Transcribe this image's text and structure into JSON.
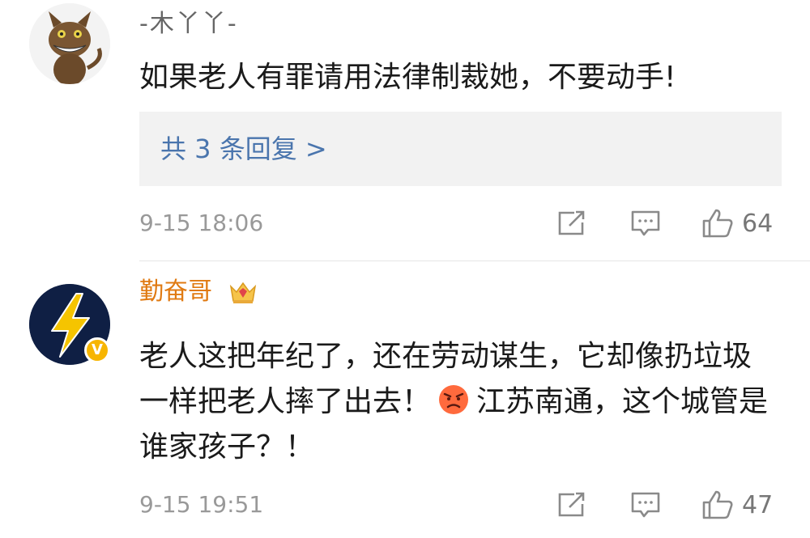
{
  "comments": [
    {
      "username": "-木丫丫-",
      "text": "如果老人有罪请用法律制裁她，不要动手!",
      "replies_link": "共 3 条回复 >",
      "timestamp": "9-15 18:06",
      "likes": "64",
      "avatar_icon": "cat-avatar"
    },
    {
      "username": "勤奋哥",
      "text_part1": "老人这把年纪了，还在劳动谋生，它却像扔垃圾一样把老人摔了出去！",
      "text_part2": "江苏南通，这个城管是谁家孩子？！",
      "timestamp": "9-15 19:51",
      "likes": "47",
      "avatar_icon": "lightning-avatar",
      "verified_badge": "V",
      "inline_emoji": "angry-face-icon",
      "username_badge": "crown-icon"
    }
  ],
  "colors": {
    "username_gray": "#666666",
    "username_vip": "#e07a12",
    "link_blue": "#4a75ad",
    "meta_gray": "#999999",
    "badge_yellow": "#f7b500"
  }
}
